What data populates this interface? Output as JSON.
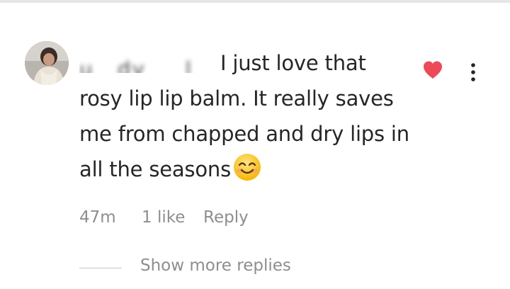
{
  "comment": {
    "username": "u ­ ­ dy ­ ­ ­ ­ l",
    "text": " I just love that rosy lip lip balm. It really saves me from chapped and dry lips in all the seasons",
    "emoji_icon": "smiling-face-emoji",
    "time": "47m",
    "likes": "1 like",
    "reply_label": "Reply",
    "liked": true
  },
  "replies": {
    "show_more_label": "Show more replies"
  },
  "colors": {
    "heart": "#ed4956",
    "text": "#262626",
    "meta": "#8e8e8e"
  }
}
